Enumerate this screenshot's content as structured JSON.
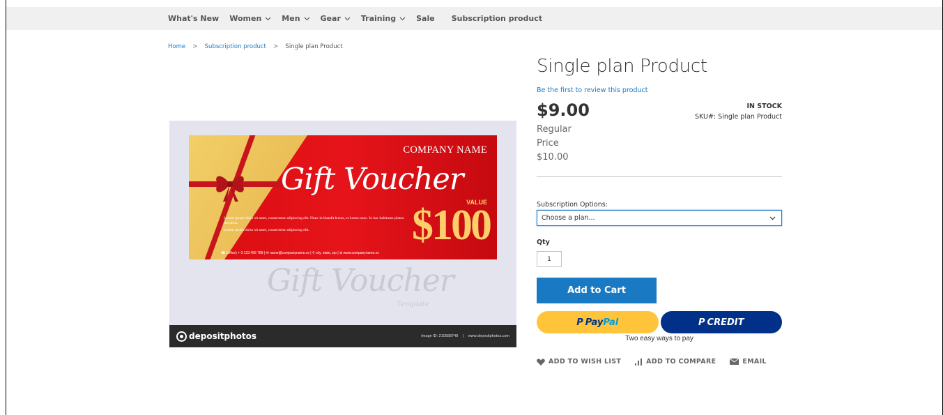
{
  "nav": {
    "items": [
      {
        "label": "What's New",
        "dropdown": false
      },
      {
        "label": "Women",
        "dropdown": true
      },
      {
        "label": "Men",
        "dropdown": true
      },
      {
        "label": "Gear",
        "dropdown": true
      },
      {
        "label": "Training",
        "dropdown": true
      },
      {
        "label": "Sale",
        "dropdown": false
      },
      {
        "label": "Subscription product",
        "dropdown": false
      }
    ]
  },
  "breadcrumb": {
    "home": "Home",
    "category": "Subscription product",
    "separator": ">",
    "current": "Single plan Product"
  },
  "product_image": {
    "company_name": "COMPANY NAME",
    "title": "Gift Voucher",
    "value_label": "VALUE",
    "amount": "$100",
    "lorem_1": "Lorem ipsum dolor sit amet, consectetur adipiscing elit. Nunc in blandit lectus, et luctus nunc. In hac habitasse platea dictumst.",
    "lorem_2": "Lorem ipsum dolor sit amet, consectetur adipiscing elit.",
    "contact": "☎ (office) + 0 123 456 789 | ✉ name@companyname.xx | ⚲ city, state, zip | ⊕ www.companyname.xx",
    "ghost_title": "Gift Voucher",
    "template_word": "Template",
    "watermark_brand": "depositphotos",
    "image_id": "Image ID: 210588748",
    "site": "www.depositphotos.com"
  },
  "product": {
    "title": "Single plan Product",
    "review_link": "Be the first to review this product",
    "price": "$9.00",
    "regular_price_label_1": "Regular",
    "regular_price_label_2": "Price",
    "regular_price": "$10.00",
    "stock_status": "IN STOCK",
    "sku_label": "SKU#:",
    "sku_value": "Single plan Product",
    "subscription_label": "Subscription Options:",
    "subscription_selected": "Choose a plan...",
    "qty_label": "Qty",
    "qty_value": "1",
    "add_to_cart": "Add to Cart"
  },
  "payment": {
    "paypal_1": "Pay",
    "paypal_2": "Pal",
    "credit": "CREDIT",
    "tagline": "Two easy ways to pay"
  },
  "actions": {
    "wishlist": "ADD TO WISH LIST",
    "compare": "ADD TO COMPARE",
    "email": "EMAIL"
  },
  "colors": {
    "link": "#1979c3",
    "paypal_gold": "#ffc439",
    "paypal_blue": "#003087"
  }
}
